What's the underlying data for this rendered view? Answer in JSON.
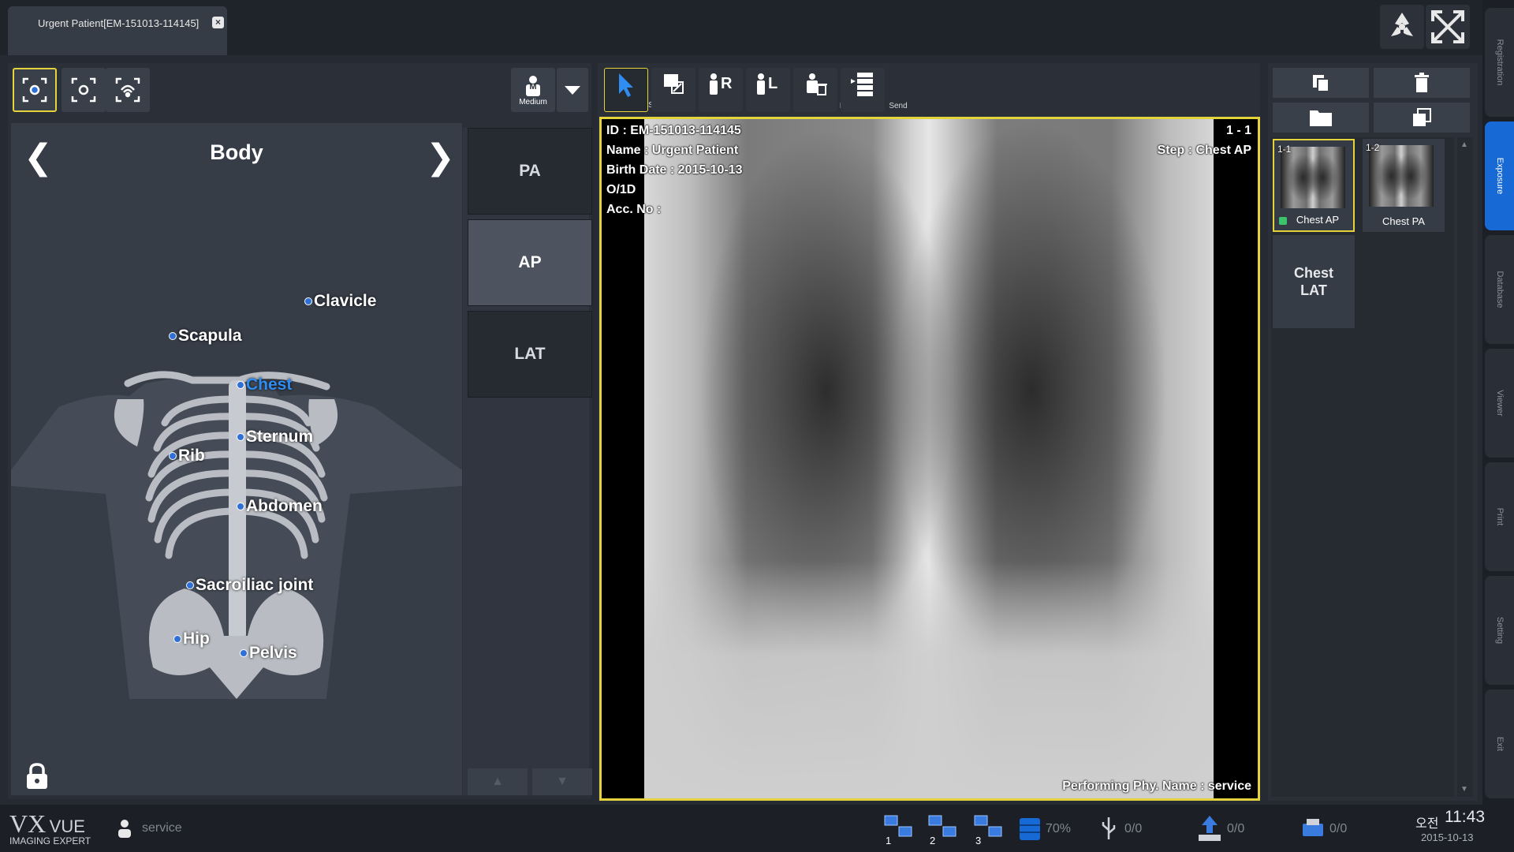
{
  "tab": {
    "title": "Urgent Patient[EM-151013-114145]",
    "close": "×"
  },
  "side_nav": [
    {
      "label": "Registration",
      "active": false
    },
    {
      "label": "Exposure",
      "active": true
    },
    {
      "label": "Database",
      "active": false
    },
    {
      "label": "Viewer",
      "active": false
    },
    {
      "label": "Print",
      "active": false
    },
    {
      "label": "Setting",
      "active": false
    },
    {
      "label": "Exit",
      "active": false
    }
  ],
  "left": {
    "detector_buttons": [
      "1",
      "2",
      "3"
    ],
    "size_label": "Medium",
    "size_icon_letter": "M",
    "body_title": "Body",
    "body_parts": [
      "Clavicle",
      "Scapula",
      "Chest",
      "Sternum",
      "Rib",
      "Abdomen",
      "Sacroiliac joint",
      "Hip",
      "Pelvis"
    ],
    "active_part": "Chest",
    "views": [
      "PA",
      "AP",
      "LAT"
    ],
    "selected_view": "AP"
  },
  "toolbar": {
    "tools": [
      {
        "label": "Select",
        "icon_text": ""
      },
      {
        "label": "Rect",
        "icon_text": ""
      },
      {
        "label": "R",
        "icon_text": "R"
      },
      {
        "label": "L",
        "icon_text": "L"
      },
      {
        "label": "Reject",
        "icon_text": ""
      },
      {
        "label": "Send",
        "icon_text": ""
      }
    ],
    "selected": "Select"
  },
  "overlay": {
    "id_line": "ID : EM-151013-114145",
    "name_line": "Name : Urgent Patient",
    "birth_line": "Birth Date : 2015-10-13",
    "sex_age_line": "O/1D",
    "acc_line": "Acc. No :",
    "series_index": "1 - 1",
    "step_line": "Step : Chest AP",
    "performer_line": "Performing Phy. Name : service"
  },
  "thumbnails": [
    {
      "num": "1-1",
      "caption": "Chest AP",
      "selected": true
    },
    {
      "num": "1-2",
      "caption": "Chest PA",
      "selected": false
    }
  ],
  "pending_step": {
    "line1": "Chest",
    "line2": "LAT"
  },
  "status": {
    "brand_main": "VX",
    "brand_sub": "VUE",
    "brand_tag": "IMAGING EXPERT",
    "user": "service",
    "detectors": [
      "1",
      "2",
      "3"
    ],
    "storage_pct": "70%",
    "usb_count": "0/0",
    "upload_count": "0/0",
    "print_count": "0/0",
    "time_prefix": "오전",
    "time": "11:43",
    "date": "2015-10-13"
  },
  "colors": {
    "accent_yellow": "#e5d33b",
    "active_blue": "#1769d6",
    "panel": "#2b3038"
  }
}
